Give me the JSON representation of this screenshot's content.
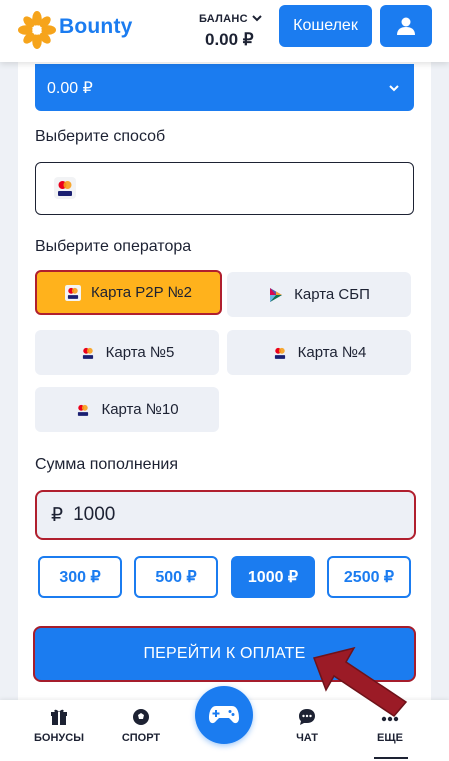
{
  "header": {
    "brand": "Bounty",
    "balance_label": "БАЛАНС",
    "balance_value": "0.00 ₽",
    "wallet_label": "Кошелек"
  },
  "deposit": {
    "currency_value": "0.00 ₽",
    "method_label": "Выберите способ",
    "operator_label": "Выберите оператора",
    "operators": [
      {
        "label": "Карта P2P №2",
        "icon": "mastercard-visa-icon",
        "selected": true
      },
      {
        "label": "Карта СБП",
        "icon": "sbp-icon",
        "selected": false
      },
      {
        "label": "Карта №5",
        "icon": "mastercard-visa-icon",
        "selected": false
      },
      {
        "label": "Карта №4",
        "icon": "mastercard-visa-icon",
        "selected": false
      },
      {
        "label": "Карта №10",
        "icon": "mastercard-visa-icon",
        "selected": false
      }
    ],
    "amount_label": "Сумма пополнения",
    "currency_symbol": "₽",
    "amount_value": "1000",
    "quick_amounts": [
      {
        "label": "300 ₽",
        "selected": false
      },
      {
        "label": "500 ₽",
        "selected": false
      },
      {
        "label": "1000 ₽",
        "selected": true
      },
      {
        "label": "2500 ₽",
        "selected": false
      }
    ],
    "pay_label": "ПЕРЕЙТИ К ОПЛАТЕ"
  },
  "nav": {
    "items": [
      {
        "label": "БОНУСЫ",
        "icon": "gift-icon"
      },
      {
        "label": "СПОРТ",
        "icon": "soccer-ball-icon"
      },
      {
        "label": "",
        "icon": "gamepad-icon"
      },
      {
        "label": "ЧАТ",
        "icon": "chat-icon"
      },
      {
        "label": "ЕЩЕ",
        "icon": "more-dots-icon"
      }
    ]
  },
  "colors": {
    "accent": "#1b7cf0",
    "selected_operator": "#ffb21c",
    "highlight_border": "#b01f2e",
    "annotation_arrow": "#9b1b26"
  }
}
